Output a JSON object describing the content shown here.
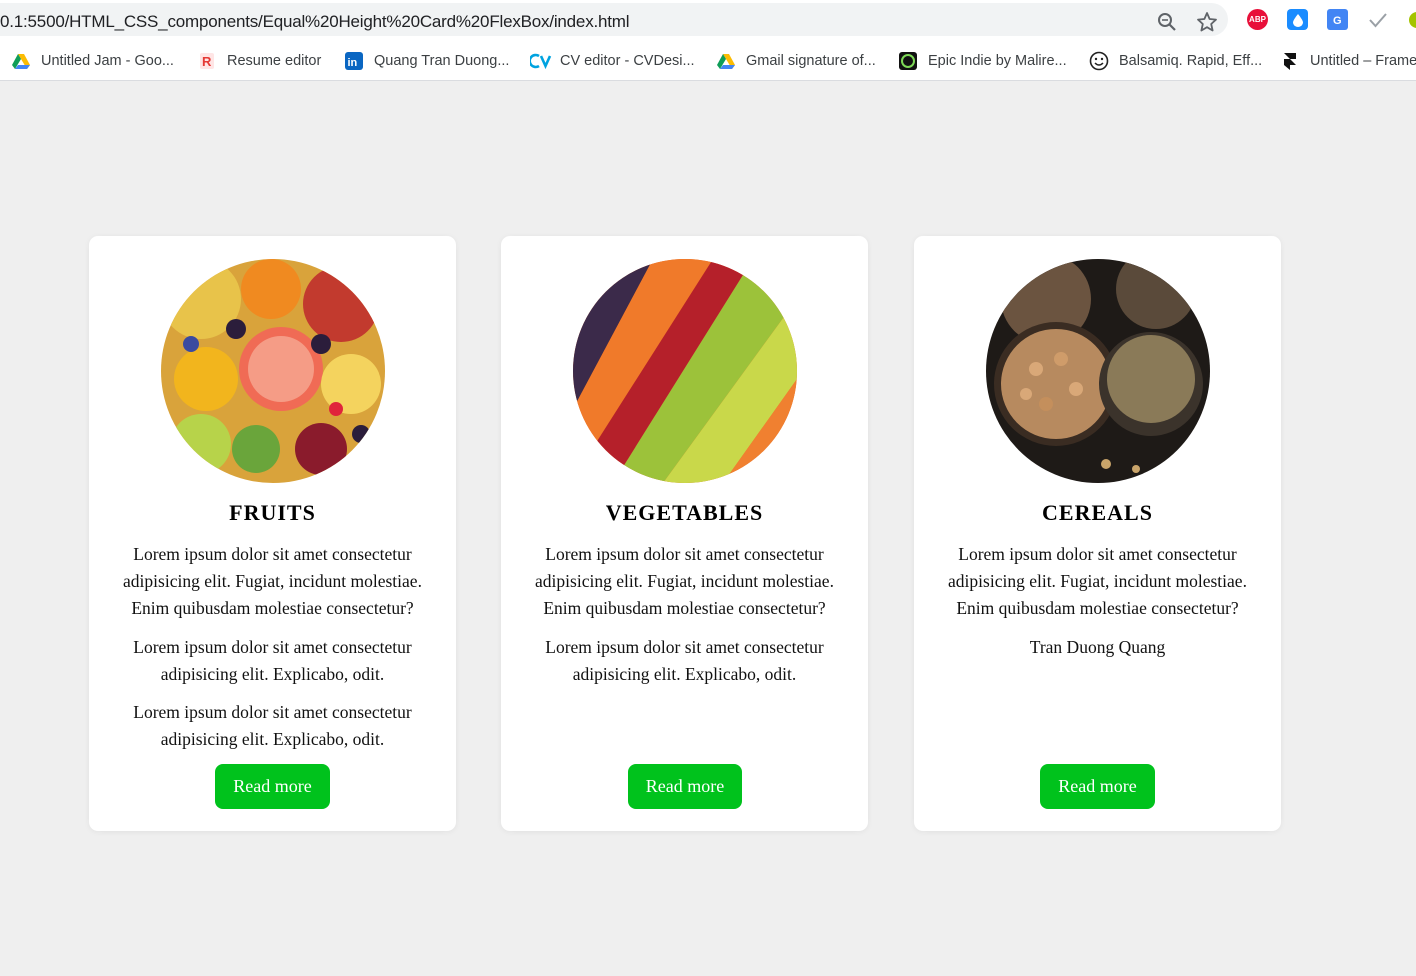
{
  "browser": {
    "url": "0.1:5500/HTML_CSS_components/Equal%20Height%20Card%20FlexBox/index.html",
    "extensions": {
      "abp_label": "ABP"
    },
    "bookmarks": [
      {
        "label": "Untitled Jam - Goo...",
        "icon": "google-drive-icon"
      },
      {
        "label": "Resume editor",
        "icon": "resume-r-icon"
      },
      {
        "label": "Quang Tran Duong...",
        "icon": "linkedin-icon"
      },
      {
        "label": "CV editor - CVDesi...",
        "icon": "cv-icon"
      },
      {
        "label": "Gmail signature of...",
        "icon": "google-drive-icon"
      },
      {
        "label": "Epic Indie by Malire...",
        "icon": "epic-indie-icon"
      },
      {
        "label": "Balsamiq. Rapid, Eff...",
        "icon": "smiley-icon"
      },
      {
        "label": "Untitled – Frame",
        "icon": "framer-icon"
      }
    ]
  },
  "cards": [
    {
      "title": "FRUITS",
      "paragraphs": [
        "Lorem ipsum dolor sit amet consectetur adipisicing elit. Fugiat, incidunt molestiae. Enim quibusdam molestiae consectetur?",
        "Lorem ipsum dolor sit amet consectetur adipisicing elit. Explicabo, odit.",
        "Lorem ipsum dolor sit amet consectetur adipisicing elit. Explicabo, odit."
      ],
      "button": "Read more"
    },
    {
      "title": "VEGETABLES",
      "paragraphs": [
        "Lorem ipsum dolor sit amet consectetur adipisicing elit. Fugiat, incidunt molestiae. Enim quibusdam molestiae consectetur?",
        "Lorem ipsum dolor sit amet consectetur adipisicing elit. Explicabo, odit."
      ],
      "button": "Read more"
    },
    {
      "title": "CEREALS",
      "paragraphs": [
        "Lorem ipsum dolor sit amet consectetur adipisicing elit. Fugiat, incidunt molestiae. Enim quibusdam molestiae consectetur?",
        "Tran Duong Quang"
      ],
      "button": "Read more"
    }
  ],
  "colors": {
    "page_background": "#efefef",
    "card_background": "#ffffff",
    "button_green": "#00c21c"
  }
}
